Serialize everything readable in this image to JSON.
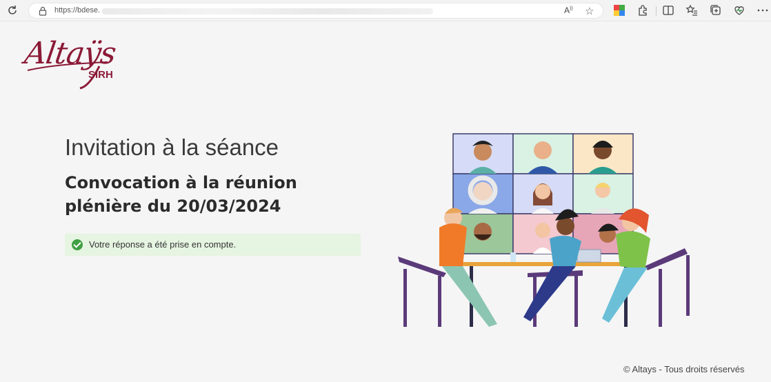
{
  "browser": {
    "url": "https://bdese.",
    "read_aloud_label": "A",
    "favorite_icon": "star-icon"
  },
  "logo": {
    "word": "Altaÿs",
    "sub": "SIRH",
    "color": "#8b1a36"
  },
  "main": {
    "title": "Invitation à la séance",
    "subtitle": "Convocation à la réunion plénière du 20/03/2024",
    "alert": {
      "text": "Votre réponse a été prise en compte.",
      "status_color": "#3fa044",
      "background": "#e6f4e2"
    }
  },
  "footer": {
    "copyright": "© Altays - Tous droits réservés"
  }
}
